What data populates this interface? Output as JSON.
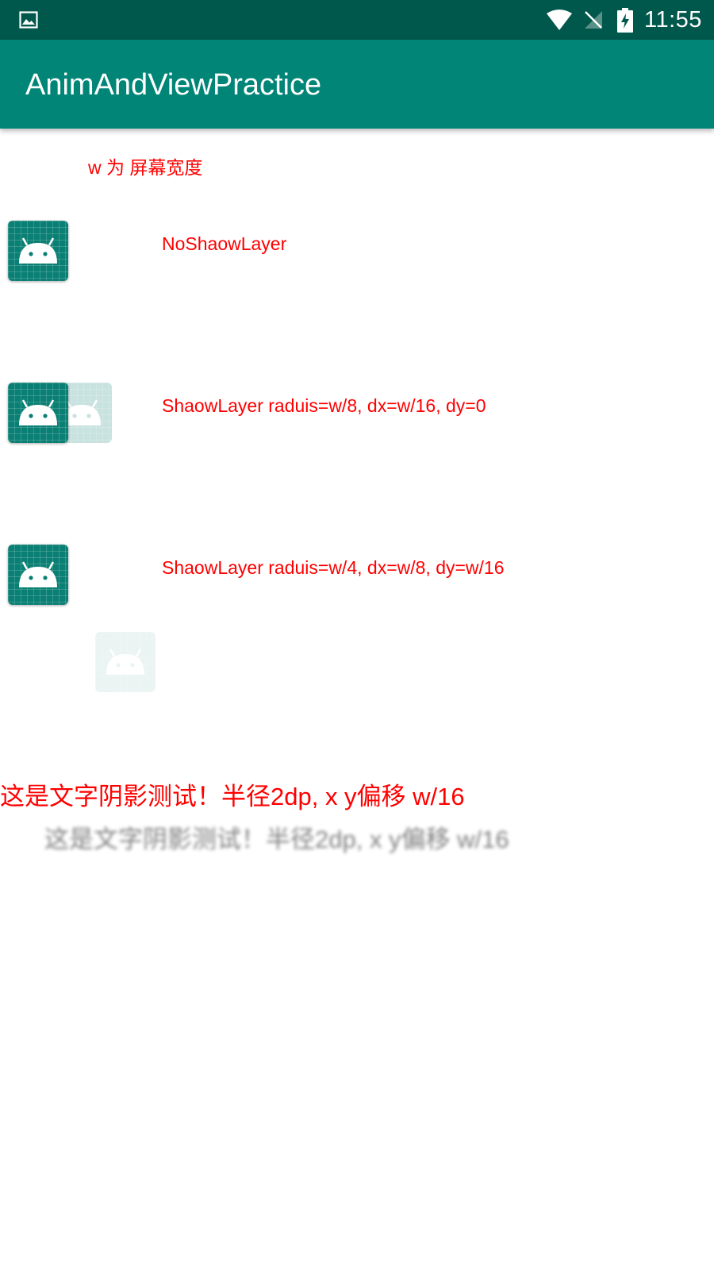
{
  "status_bar": {
    "time": "11:55",
    "icons": [
      "gallery-icon",
      "wifi-icon",
      "no-sim-icon",
      "battery-charging-icon"
    ]
  },
  "app_bar": {
    "title": "AnimAndViewPractice",
    "color": "#008577",
    "status_color": "#00574b"
  },
  "content": {
    "note": "w 为 屏幕宽度",
    "rows": [
      {
        "label": "NoShaowLayer"
      },
      {
        "label": "ShaowLayer raduis=w/8, dx=w/16, dy=0"
      },
      {
        "label": "ShaowLayer raduis=w/4, dx=w/8, dy=w/16"
      }
    ],
    "text_shadow_demo": "这是文字阴影测试！半径2dp, x y偏移 w/16",
    "text_color": "#ff0000",
    "icon_name": "android-robot-icon"
  }
}
